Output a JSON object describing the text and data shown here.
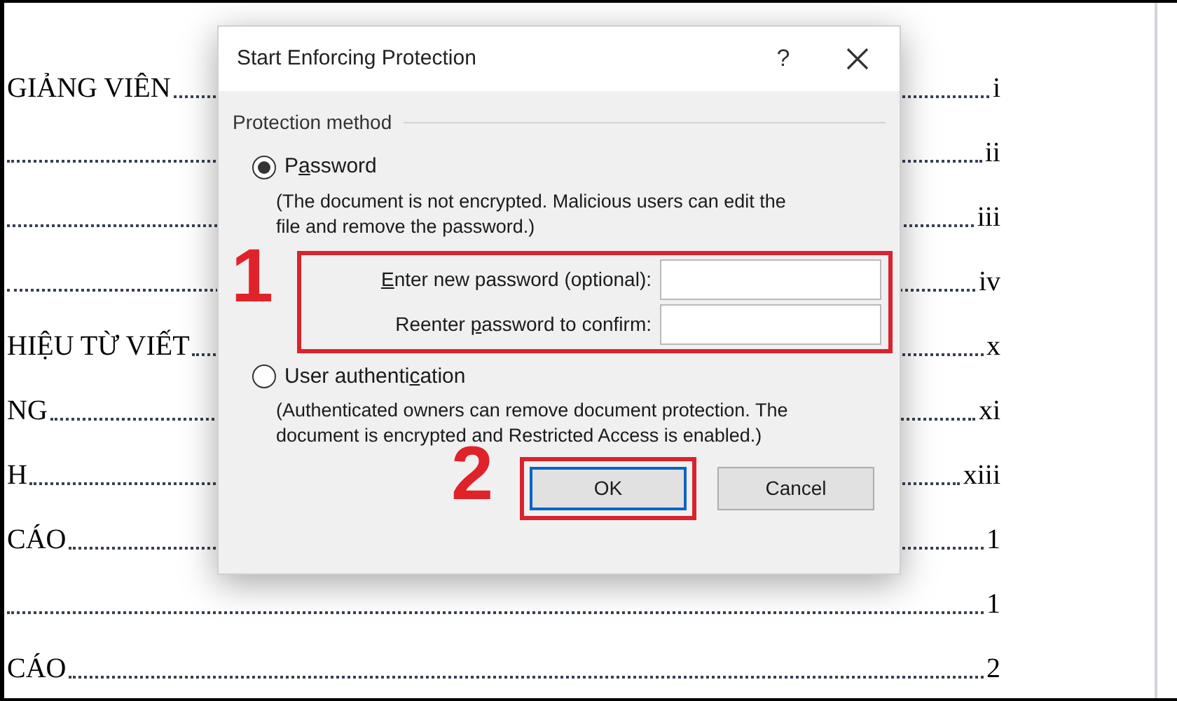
{
  "document": {
    "toc_rows": [
      {
        "text": "GIẢNG VIÊN",
        "page": "i"
      },
      {
        "text": "",
        "page": "ii"
      },
      {
        "text": "",
        "page": "iii"
      },
      {
        "text": "",
        "page": "iv"
      },
      {
        "text": "HIỆU TỪ VIẾT",
        "page": "x"
      },
      {
        "text": "NG",
        "page": "xi"
      },
      {
        "text": "H",
        "page": "xiii"
      },
      {
        "text": "CÁO",
        "page": "1"
      },
      {
        "text": "",
        "page": "1"
      },
      {
        "text": "CÁO",
        "page": "2"
      }
    ]
  },
  "dialog": {
    "title": "Start Enforcing Protection",
    "help": "?",
    "group_label": "Protection method",
    "options": [
      {
        "label_parts": [
          {
            "text": "P",
            "underlined": false
          },
          {
            "text": "a",
            "underlined": true
          },
          {
            "text": "ssword",
            "underlined": false
          }
        ],
        "selected": true,
        "note": "(The document is not encrypted. Malicious users can edit the file and remove the password.)",
        "callout": "1",
        "fields": [
          {
            "label_parts": [
              {
                "text": "E",
                "underlined": true
              },
              {
                "text": "nter new password (optional):",
                "underlined": false
              }
            ]
          },
          {
            "label_parts": [
              {
                "text": "Reenter ",
                "underlined": false
              },
              {
                "text": "p",
                "underlined": true
              },
              {
                "text": "assword to confirm:",
                "underlined": false
              }
            ]
          }
        ]
      },
      {
        "label_parts": [
          {
            "text": "User authenti",
            "underlined": false
          },
          {
            "text": "c",
            "underlined": true
          },
          {
            "text": "ation",
            "underlined": false
          }
        ],
        "selected": false,
        "note": "(Authenticated owners can remove document protection. The document is encrypted and Restricted Access is enabled.)"
      }
    ],
    "buttons": [
      {
        "label": "OK",
        "default": true,
        "callout": "2"
      },
      {
        "label": "Cancel",
        "default": false
      }
    ]
  }
}
